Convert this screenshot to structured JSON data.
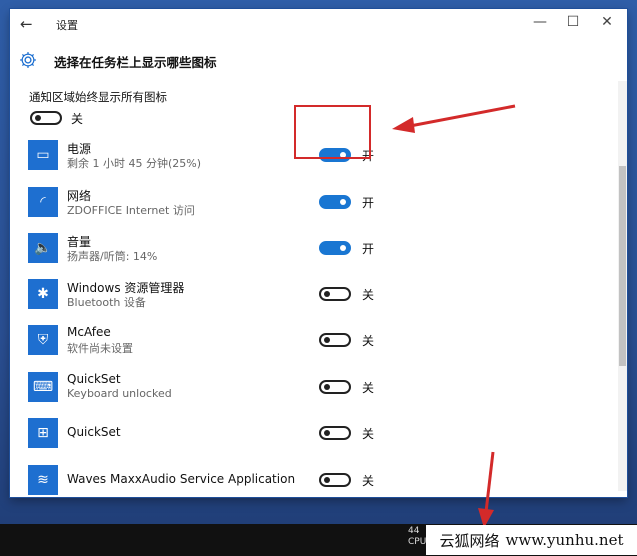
{
  "window": {
    "back_glyph": "←",
    "title": "设置",
    "controls": {
      "minimize": "—",
      "maximize": "☐",
      "close": "✕"
    }
  },
  "header": {
    "page_title": "选择在任务栏上显示哪些图标"
  },
  "always_show": {
    "label": "通知区域始终显示所有图标",
    "toggle_state": false,
    "state_text": "关"
  },
  "items": [
    {
      "icon": "battery-icon",
      "icon_glyph": "▭",
      "name": "电源",
      "subtitle": "剩余 1 小时 45 分钟(25%)",
      "on": true,
      "state_text": "开"
    },
    {
      "icon": "wifi-icon",
      "icon_glyph": "◜",
      "name": "网络",
      "subtitle": "ZDOFFICE Internet 访问",
      "on": true,
      "state_text": "开"
    },
    {
      "icon": "volume-icon",
      "icon_glyph": "🔈",
      "name": "音量",
      "subtitle": "扬声器/听筒: 14%",
      "on": true,
      "state_text": "开"
    },
    {
      "icon": "bluetooth-icon",
      "icon_glyph": "✱",
      "name": "Windows 资源管理器",
      "subtitle": "Bluetooth 设备",
      "on": false,
      "state_text": "关"
    },
    {
      "icon": "mcafee-shield-icon",
      "icon_glyph": "⛨",
      "name": "McAfee",
      "subtitle": "软件尚未设置",
      "on": false,
      "state_text": "关"
    },
    {
      "icon": "keyboard-icon",
      "icon_glyph": "⌨",
      "name": "QuickSet",
      "subtitle": "Keyboard unlocked",
      "on": false,
      "state_text": "关"
    },
    {
      "icon": "quickset-icon",
      "icon_glyph": "⊞",
      "name": "QuickSet",
      "subtitle": "",
      "on": false,
      "state_text": "关"
    },
    {
      "icon": "waves-audio-icon",
      "icon_glyph": "≋",
      "name": "Waves MaxxAudio Service Application",
      "subtitle": "",
      "on": false,
      "state_text": "关"
    }
  ],
  "taskbar": {
    "tray_line1": "44",
    "tray_line2": "CPU"
  },
  "watermark": {
    "text": "云狐网络",
    "url": "www.yunhu.net"
  },
  "colors": {
    "accent": "#1976d2",
    "annotation_red": "#d32a2a",
    "taskbar": "#111111"
  }
}
